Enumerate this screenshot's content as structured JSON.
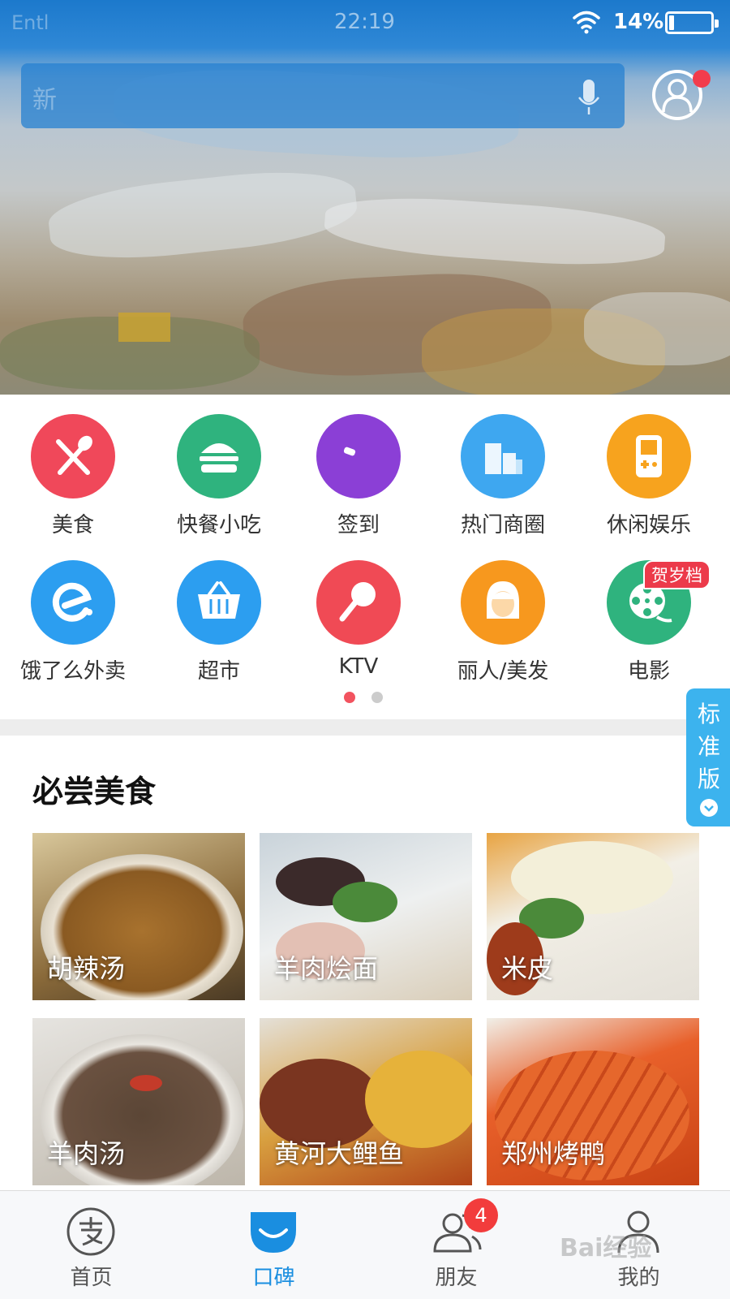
{
  "status_bar": {
    "carrier": "Entl",
    "time": "22:19",
    "battery": "14%",
    "wifi_icon": "wifi-icon",
    "battery_icon": "battery-icon"
  },
  "search": {
    "placeholder": "新",
    "mic_icon": "microphone-icon"
  },
  "profile": {
    "icon": "user-icon",
    "has_notification": true
  },
  "categories": [
    {
      "label": "美食",
      "icon": "fork-spoon-icon",
      "color": "#f0485a"
    },
    {
      "label": "快餐小吃",
      "icon": "burger-icon",
      "color": "#2fb37e"
    },
    {
      "label": "签到",
      "icon": "checkin-icon",
      "color": "#8b3fd6"
    },
    {
      "label": "热门商圈",
      "icon": "buildings-icon",
      "color": "#3ea7f0"
    },
    {
      "label": "休闲娱乐",
      "icon": "gamepad-icon",
      "color": "#f7a31e"
    },
    {
      "label": "饿了么外卖",
      "icon": "eleme-icon",
      "color": "#2c9ef0"
    },
    {
      "label": "超市",
      "icon": "basket-icon",
      "color": "#2c9ef0"
    },
    {
      "label": "KTV",
      "icon": "microphone-icon",
      "color": "#f04a55"
    },
    {
      "label": "丽人/美发",
      "icon": "woman-icon",
      "color": "#f7981e"
    },
    {
      "label": "电影",
      "icon": "film-reel-icon",
      "color": "#2fb37e"
    }
  ],
  "movie_tag": "贺岁档",
  "pager": {
    "pages": 2,
    "current": 1,
    "active_color": "#f2535f",
    "inactive_color": "#cccccc"
  },
  "mode_tab": {
    "label": "标准版"
  },
  "section": {
    "title": "必尝美食",
    "items": [
      {
        "name": "胡辣汤"
      },
      {
        "name": "羊肉烩面"
      },
      {
        "name": "米皮"
      },
      {
        "name": "羊肉汤"
      },
      {
        "name": "黄河大鲤鱼"
      },
      {
        "name": "郑州烤鸭"
      }
    ]
  },
  "bottom_nav": {
    "items": [
      {
        "label": "首页",
        "icon": "alipay-icon",
        "active": false
      },
      {
        "label": "口碑",
        "icon": "koubei-icon",
        "active": true
      },
      {
        "label": "朋友",
        "icon": "friends-icon",
        "active": false,
        "badge": "4"
      },
      {
        "label": "我的",
        "icon": "profile-icon",
        "active": false
      }
    ],
    "active_color": "#1a8ee0"
  },
  "watermark": "Bai经验"
}
